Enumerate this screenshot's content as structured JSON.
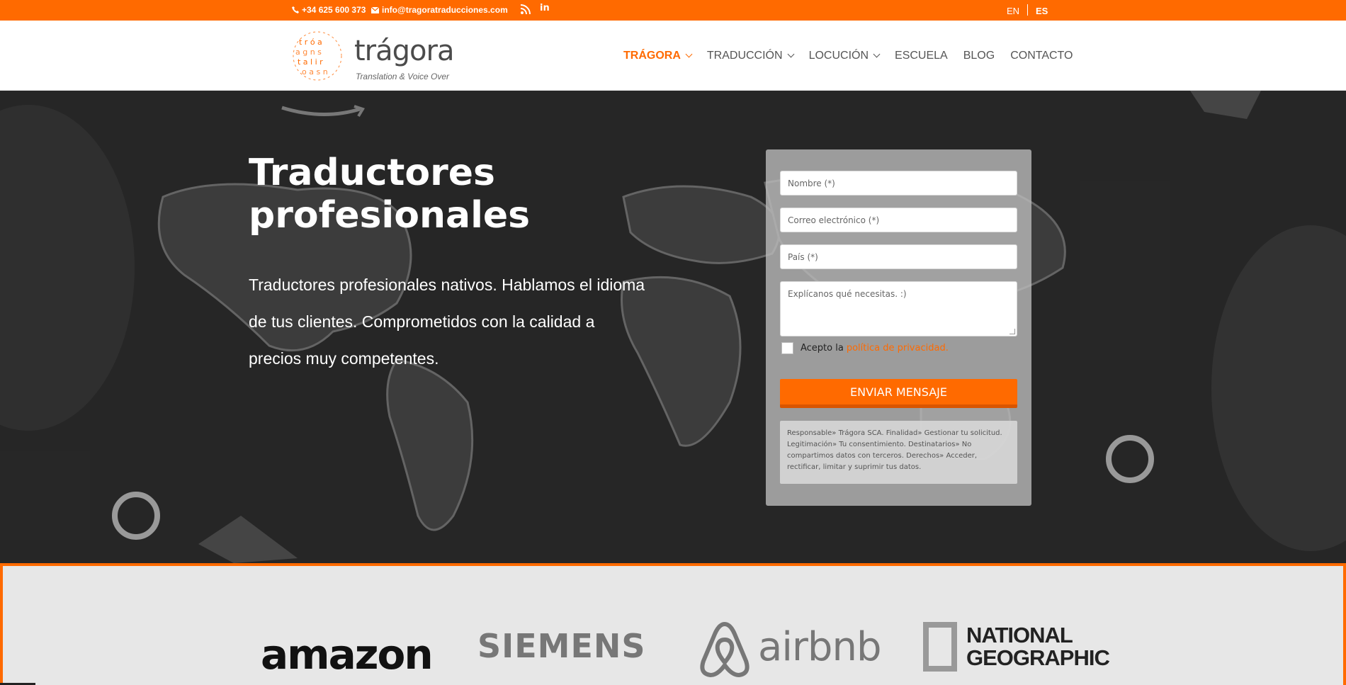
{
  "topbar": {
    "phone": "+34 625 600 373",
    "email": "info@tragoratraducciones.com",
    "languages": {
      "en": "EN",
      "es": "ES"
    }
  },
  "logo": {
    "name": "trágora",
    "tagline": "Translation & Voice Over"
  },
  "nav": {
    "items": [
      {
        "label": "TRÁGORA",
        "active": true
      },
      {
        "label": "TRADUCCIÓN"
      },
      {
        "label": "LOCUCIÓN"
      },
      {
        "label": "ESCUELA"
      },
      {
        "label": "BLOG"
      },
      {
        "label": "CONTACTO"
      }
    ]
  },
  "hero": {
    "title_line1": "Traductores",
    "title_line2": "profesionales",
    "text": "Traductores profesionales nativos. Hablamos el idioma de tus clientes. Comprometidos con la calidad a precios muy competentes."
  },
  "form": {
    "name_placeholder": "Nombre (*)",
    "email_placeholder": "Correo electrónico (*)",
    "country_placeholder": "País (*)",
    "message_placeholder": "Explícanos qué necesitas. :)",
    "consent_text": "Acepto la",
    "consent_link": "política de privacidad.",
    "submit": "ENVIAR MENSAJE",
    "legal": "Responsable» Trágora SCA. Finalidad» Gestionar tu solicitud. Legitimación» Tu consentimiento. Destinatarios» No compartimos datos con terceros. Derechos» Acceder, rectificar, limitar y suprimir tus datos."
  },
  "clients": {
    "amazon": "amazon",
    "siemens": "SIEMENS",
    "airbnb": "airbnb",
    "natgeo_line1": "NATIONAL",
    "natgeo_line2": "GEOGRAPHIC"
  },
  "colors": {
    "accent": "#ff6a00",
    "hero_bg": "#2c2c2c",
    "clients_bg": "#e7e7e7"
  }
}
